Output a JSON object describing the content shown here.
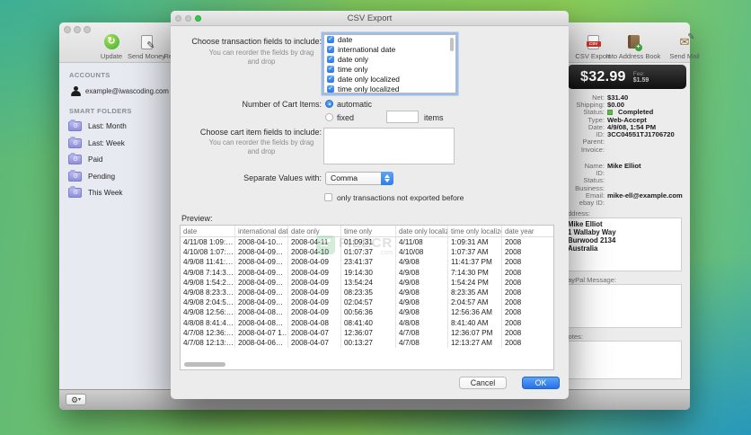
{
  "desktop": {
    "gradient_teal": "#3aae98",
    "gradient_green": "#8ccd56",
    "gradient_blue": "#2294c0"
  },
  "watermark": {
    "text": "FILECR",
    "suffix": ".com"
  },
  "main_window": {
    "toolbar": {
      "left": [
        {
          "label": "Update",
          "icon": "update-icon"
        },
        {
          "label": "Send Money",
          "icon": "send-money-icon"
        },
        {
          "label": "Refund Transac",
          "icon": "refund-transaction-icon"
        }
      ],
      "right": [
        {
          "label": "CSV Export",
          "icon": "csv-export-icon"
        },
        {
          "label": "Into Address Book",
          "icon": "address-book-icon"
        },
        {
          "label": "Send Mail",
          "icon": "send-mail-icon"
        }
      ]
    },
    "sidebar": {
      "accounts_header": "ACCOUNTS",
      "account": "example@iwascoding.com",
      "smart_folders_header": "SMART FOLDERS",
      "folders": [
        "Last: Month",
        "Last: Week",
        "Paid",
        "Pending",
        "This Week"
      ]
    },
    "details": {
      "amount": "$32.99",
      "fee_label": "Fee:",
      "fee_value": "$1.59",
      "status_color": "#63b84f",
      "payment_rows": [
        {
          "label": "Net:",
          "value": "$31.40"
        },
        {
          "label": "Shipping:",
          "value": "$0.00"
        },
        {
          "label": "Status:",
          "value": "Completed",
          "status_dot": true
        },
        {
          "label": "Type:",
          "value": "Web-Accept"
        },
        {
          "label": "Date:",
          "value": "4/9/08, 1:54 PM"
        },
        {
          "label": "ID:",
          "value": "3CC04551TJ1706720"
        },
        {
          "label": "Parent:",
          "value": ""
        },
        {
          "label": "Invoice:",
          "value": ""
        }
      ],
      "buyer_rows": [
        {
          "label": "Name:",
          "value": "Mike Elliot"
        },
        {
          "label": "ID:",
          "value": ""
        },
        {
          "label": "Status:",
          "value": ""
        },
        {
          "label": "Business:",
          "value": ""
        },
        {
          "label": "Email:",
          "value": "mike-ell@example.com"
        },
        {
          "label": "ebay ID:",
          "value": ""
        }
      ],
      "address_label": "Address:",
      "address_lines": [
        "Mike Elliot",
        "1 Wallaby Way",
        "Burwood 2134",
        "Australia"
      ],
      "paypal_message_label": "PayPal Message:",
      "notes_label": "Notes:"
    },
    "statusbar": {
      "gear_button": "⚙"
    }
  },
  "dialog": {
    "title": "CSV Export",
    "fields_label": "Choose transaction fields to include:",
    "reorder_hint": "You can reorder the fields by drag and drop",
    "transaction_fields": [
      "date",
      "international date",
      "date only",
      "time only",
      "date only localized",
      "time only localized"
    ],
    "cart_items_label": "Number of Cart Items:",
    "automatic_label": "automatic",
    "fixed_label": "fixed",
    "fixed_value": "",
    "items_label": "items",
    "cart_fields_label": "Choose cart item fields to include:",
    "separator_label": "Separate Values with:",
    "separator_value": "Comma",
    "only_new_label": "only transactions not exported before",
    "preview_label": "Preview:",
    "table": {
      "columns": [
        "date",
        "international date",
        "date only",
        "time only",
        "date only localized",
        "time only localized",
        "date year"
      ],
      "rows": [
        [
          "4/11/08 1:09:…",
          "2008-04-10…",
          "2008-04-11",
          "01:09:31",
          "4/11/08",
          "1:09:31 AM",
          "2008"
        ],
        [
          "4/10/08 1:07:…",
          "2008-04-09…",
          "2008-04-10",
          "01:07:37",
          "4/10/08",
          "1:07:37 AM",
          "2008"
        ],
        [
          "4/9/08 11:41:…",
          "2008-04-09…",
          "2008-04-09",
          "23:41:37",
          "4/9/08",
          "11:41:37 PM",
          "2008"
        ],
        [
          "4/9/08 7:14:3…",
          "2008-04-09…",
          "2008-04-09",
          "19:14:30",
          "4/9/08",
          "7:14:30 PM",
          "2008"
        ],
        [
          "4/9/08 1:54:2…",
          "2008-04-09…",
          "2008-04-09",
          "13:54:24",
          "4/9/08",
          "1:54:24 PM",
          "2008"
        ],
        [
          "4/9/08 8:23:3…",
          "2008-04-09…",
          "2008-04-09",
          "08:23:35",
          "4/9/08",
          "8:23:35 AM",
          "2008"
        ],
        [
          "4/9/08 2:04:5…",
          "2008-04-09…",
          "2008-04-09",
          "02:04:57",
          "4/9/08",
          "2:04:57 AM",
          "2008"
        ],
        [
          "4/9/08 12:56:…",
          "2008-04-08…",
          "2008-04-09",
          "00:56:36",
          "4/9/08",
          "12:56:36 AM",
          "2008"
        ],
        [
          "4/8/08 8:41:4…",
          "2008-04-08…",
          "2008-04-08",
          "08:41:40",
          "4/8/08",
          "8:41:40 AM",
          "2008"
        ],
        [
          "4/7/08 12:36:…",
          "2008-04-07 1…",
          "2008-04-07",
          "12:36:07",
          "4/7/08",
          "12:36:07 PM",
          "2008"
        ],
        [
          "4/7/08 12:13:…",
          "2008-04-06…",
          "2008-04-07",
          "00:13:27",
          "4/7/08",
          "12:13:27 AM",
          "2008"
        ]
      ]
    },
    "cancel_label": "Cancel",
    "ok_label": "OK",
    "accent_blue": "#2f7de8"
  }
}
